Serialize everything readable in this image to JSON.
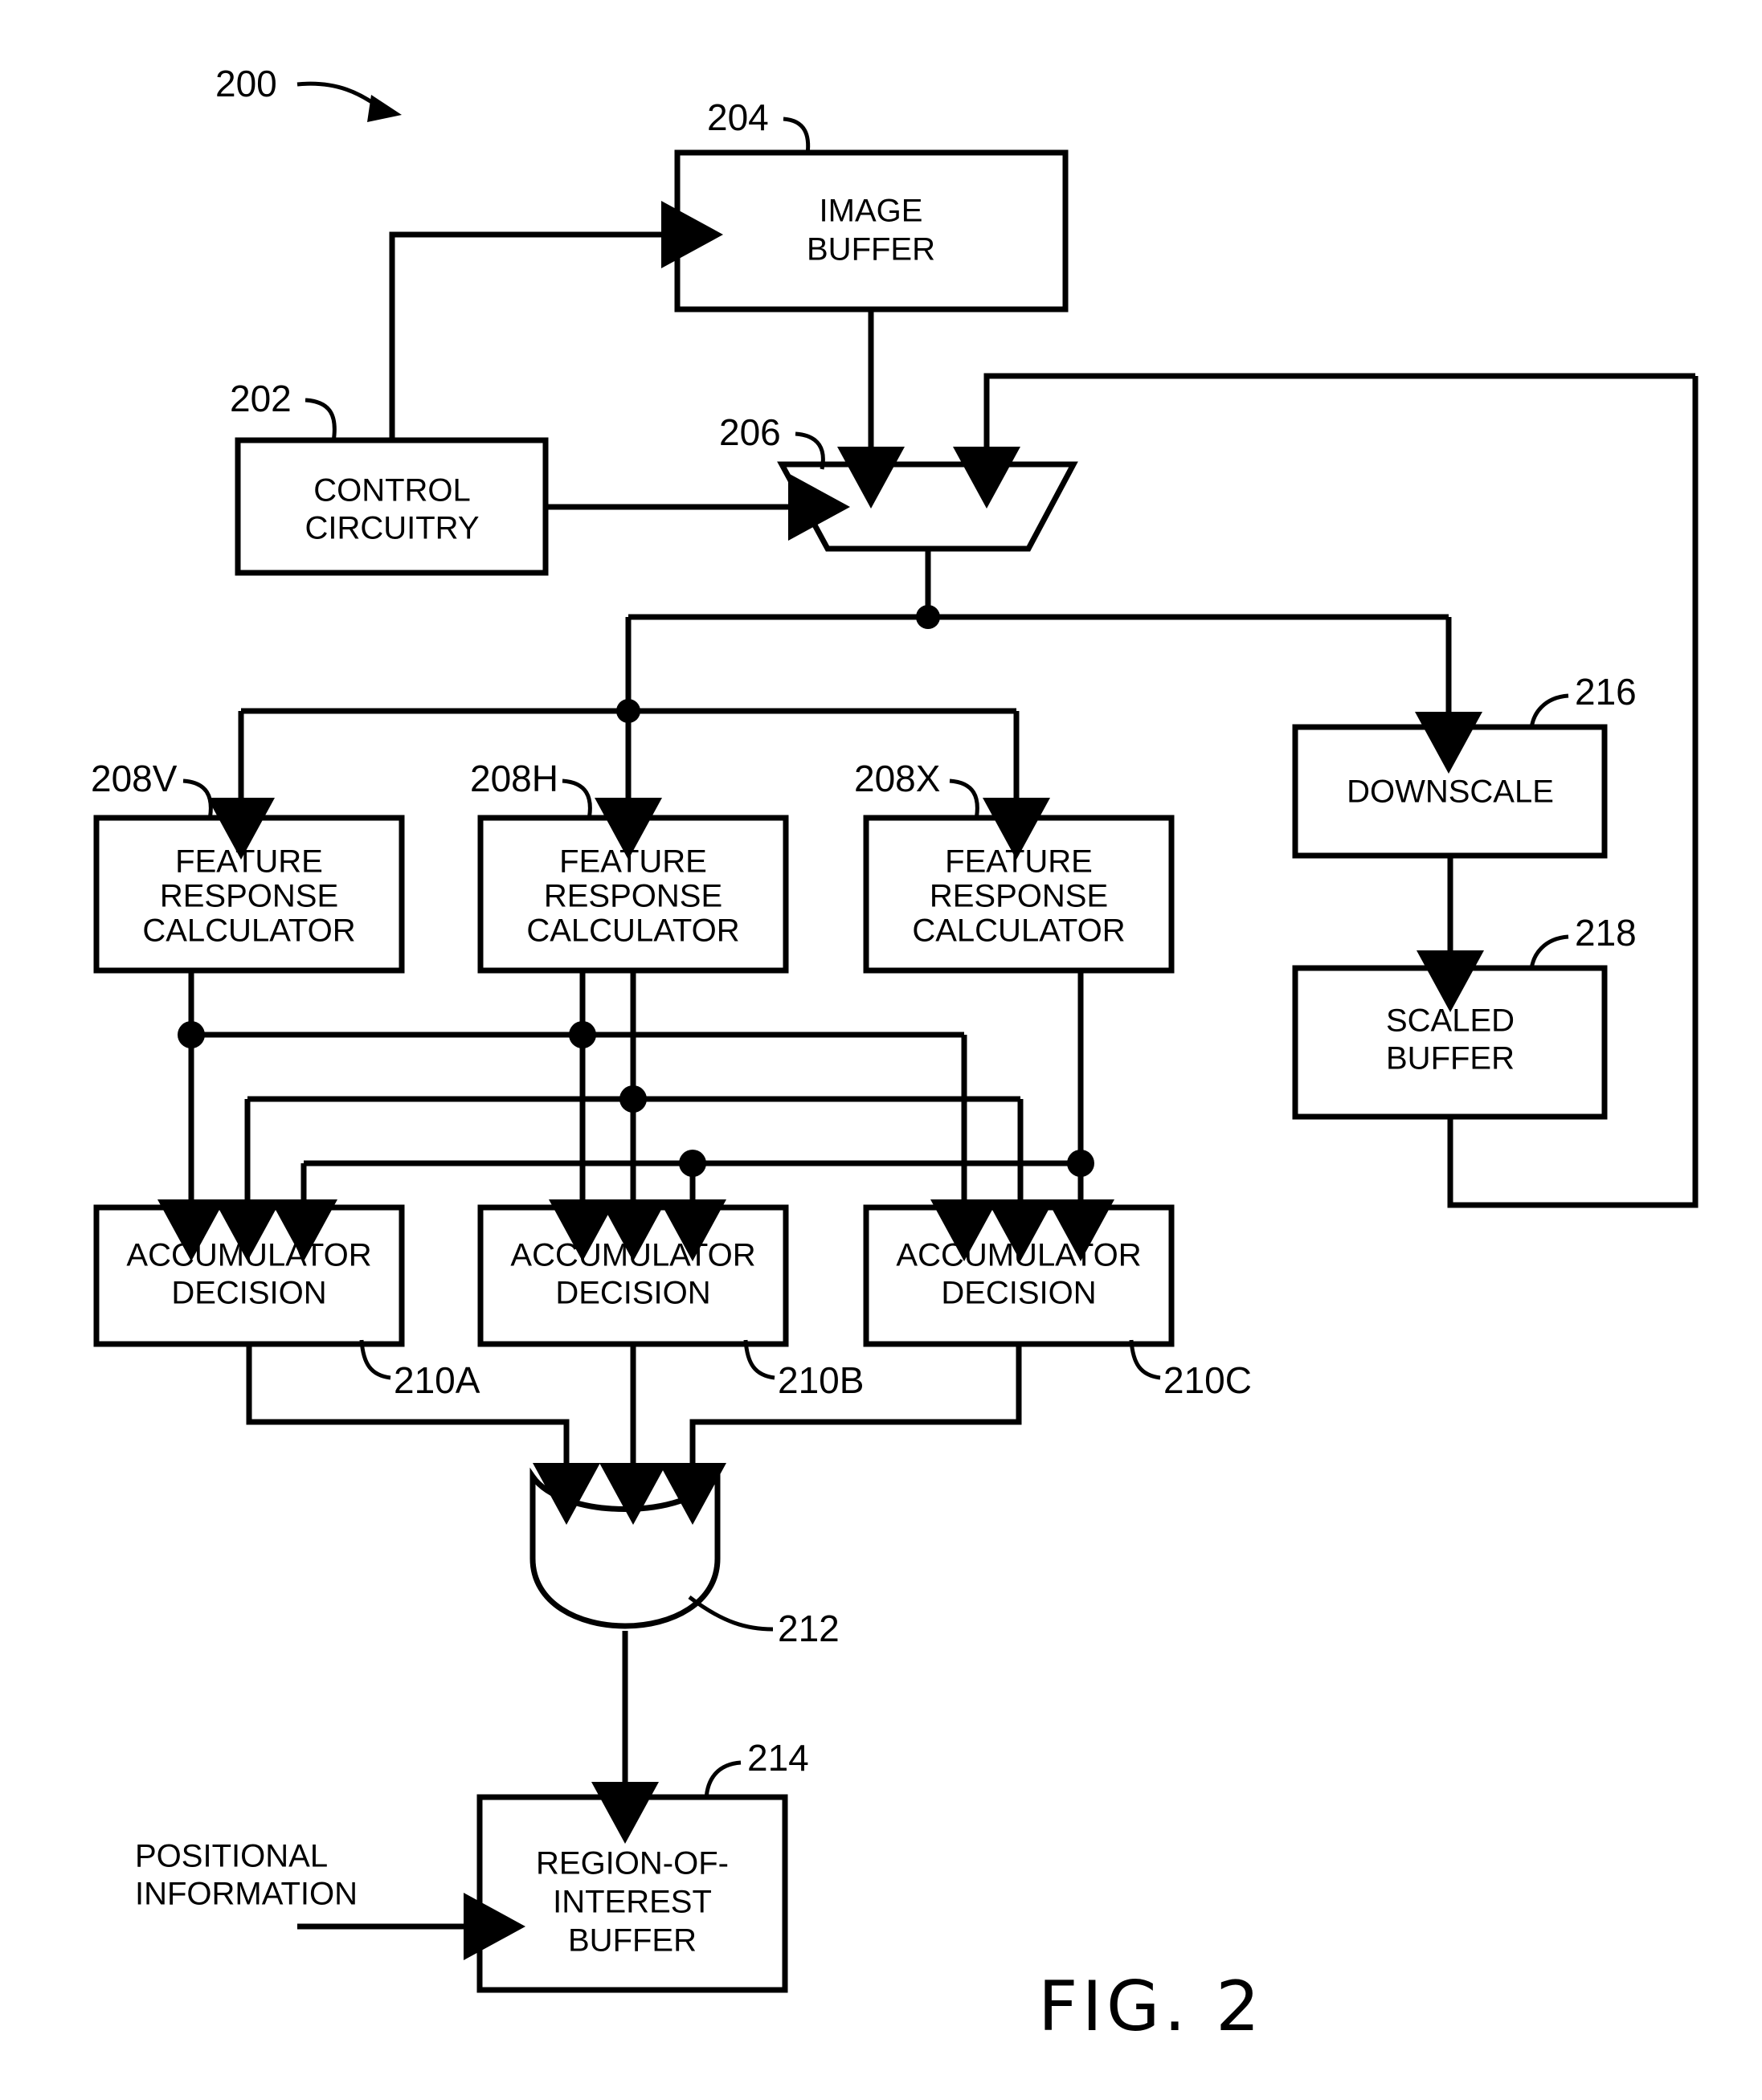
{
  "figure": {
    "caption": "FIG. 2",
    "system_ref": "200"
  },
  "blocks": [
    {
      "id": "image-buffer",
      "ref": "204",
      "lines": [
        "IMAGE",
        "BUFFER"
      ]
    },
    {
      "id": "control-circuitry",
      "ref": "202",
      "lines": [
        "CONTROL",
        "CIRCUITRY"
      ]
    },
    {
      "id": "multiplexer",
      "ref": "206",
      "lines": []
    },
    {
      "id": "feature-response-calculator-v",
      "ref": "208V",
      "lines": [
        "FEATURE",
        "RESPONSE",
        "CALCULATOR"
      ]
    },
    {
      "id": "feature-response-calculator-h",
      "ref": "208H",
      "lines": [
        "FEATURE",
        "RESPONSE",
        "CALCULATOR"
      ]
    },
    {
      "id": "feature-response-calculator-x",
      "ref": "208X",
      "lines": [
        "FEATURE",
        "RESPONSE",
        "CALCULATOR"
      ]
    },
    {
      "id": "downscale",
      "ref": "216",
      "lines": [
        "DOWNSCALE"
      ]
    },
    {
      "id": "scaled-buffer",
      "ref": "218",
      "lines": [
        "SCALED",
        "BUFFER"
      ]
    },
    {
      "id": "accumulator-decision-a",
      "ref": "210A",
      "lines": [
        "ACCUMULATOR",
        "DECISION"
      ]
    },
    {
      "id": "accumulator-decision-b",
      "ref": "210B",
      "lines": [
        "ACCUMULATOR",
        "DECISION"
      ]
    },
    {
      "id": "accumulator-decision-c",
      "ref": "210C",
      "lines": [
        "ACCUMULATOR",
        "DECISION"
      ]
    },
    {
      "id": "or-gate",
      "ref": "212",
      "lines": []
    },
    {
      "id": "region-of-interest-buffer",
      "ref": "214",
      "lines": [
        "REGION-OF-",
        "INTEREST",
        "BUFFER"
      ]
    }
  ],
  "labels": {
    "image_buffer_l1": "IMAGE",
    "image_buffer_l2": "BUFFER",
    "control_l1": "CONTROL",
    "control_l2": "CIRCUITRY",
    "frc_l1": "FEATURE",
    "frc_l2": "RESPONSE",
    "frc_l3": "CALCULATOR",
    "downscale": "DOWNSCALE",
    "scaled_l1": "SCALED",
    "scaled_l2": "BUFFER",
    "accum_l1": "ACCUMULATOR",
    "accum_l2": "DECISION",
    "roi_l1": "REGION-OF-",
    "roi_l2": "INTEREST",
    "roi_l3": "BUFFER",
    "positional_l1": "POSITIONAL",
    "positional_l2": "INFORMATION"
  },
  "refs": {
    "system": "200",
    "control": "202",
    "image_buffer": "204",
    "mux": "206",
    "frc_v": "208V",
    "frc_h": "208H",
    "frc_x": "208X",
    "accum_a": "210A",
    "accum_b": "210B",
    "accum_c": "210C",
    "or_gate": "212",
    "roi_buffer": "214",
    "downscale": "216",
    "scaled_buffer": "218"
  },
  "colors": {
    "ink": "#000000",
    "paper": "#ffffff"
  }
}
